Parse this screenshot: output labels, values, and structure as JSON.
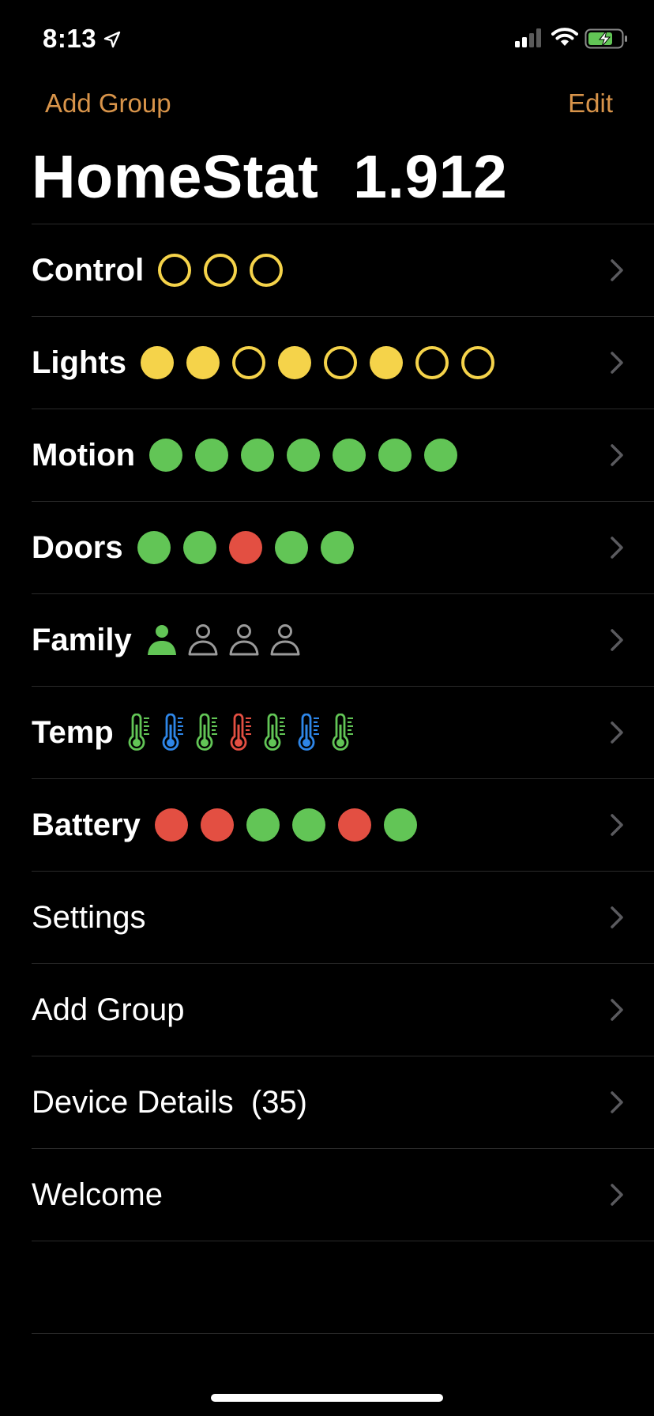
{
  "status": {
    "time": "8:13",
    "icons": [
      "location-arrow-icon",
      "cellular-signal-icon",
      "wifi-icon",
      "battery-charging-icon"
    ]
  },
  "nav": {
    "left_label": "Add Group",
    "right_label": "Edit",
    "accent_color": "#D8944A"
  },
  "title": "HomeStat  1.912",
  "colors": {
    "yellow": "#F5D34A",
    "green": "#62C556",
    "red": "#E34F42",
    "blue": "#2E86E8",
    "gray": "#9A9A9A",
    "chevron": "#5A5A5E"
  },
  "groups": [
    {
      "label": "Control",
      "kind": "dots",
      "items": [
        "hollow-yellow",
        "hollow-yellow",
        "hollow-yellow"
      ]
    },
    {
      "label": "Lights",
      "kind": "dots",
      "items": [
        "filled-yellow",
        "filled-yellow",
        "hollow-yellow",
        "filled-yellow",
        "hollow-yellow",
        "filled-yellow",
        "hollow-yellow",
        "hollow-yellow"
      ]
    },
    {
      "label": "Motion",
      "kind": "dots",
      "items": [
        "green",
        "green",
        "green",
        "green",
        "green",
        "green",
        "green"
      ]
    },
    {
      "label": "Doors",
      "kind": "dots",
      "items": [
        "green",
        "green",
        "red",
        "green",
        "green"
      ]
    },
    {
      "label": "Family",
      "kind": "people",
      "items": [
        "present",
        "away",
        "away",
        "away"
      ]
    },
    {
      "label": "Temp",
      "kind": "thermo",
      "items": [
        "green",
        "blue",
        "green",
        "red",
        "green",
        "blue",
        "green"
      ]
    },
    {
      "label": "Battery",
      "kind": "dots",
      "items": [
        "red",
        "red",
        "green",
        "green",
        "red",
        "green"
      ]
    }
  ],
  "menu": [
    {
      "label": "Settings"
    },
    {
      "label": "Add Group"
    },
    {
      "label": "Device Details  (35)"
    },
    {
      "label": "Welcome"
    }
  ]
}
